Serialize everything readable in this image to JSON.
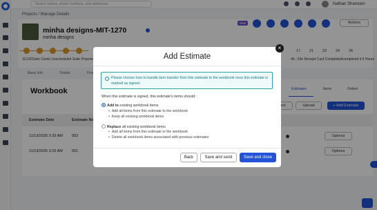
{
  "topbar": {
    "search_placeholder": "Search names, phone numbers, and addresses",
    "user_name": "Nathan Shamoon"
  },
  "breadcrumb": "Projects / Manage Details",
  "project": {
    "title": "minha designs-MIT-1270",
    "subtitle": "minha designs",
    "new_badge": "New",
    "actions_label": "Actions",
    "progress_left": "11/13/Outer Cards Unscheduled Suite Proposal",
    "progress_right": "rth : File Receipt Cauf Completed/completed it 6 Hours",
    "stages": [
      "17",
      "21",
      "23",
      "24",
      "26"
    ]
  },
  "tabs": [
    "Basic Info",
    "Details",
    "Financials"
  ],
  "workbook": {
    "title": "Workbook",
    "right_tabs": [
      "Estimates",
      "Items",
      "Orders"
    ],
    "reject_label": "Reject",
    "upload_label": "Upload",
    "add_estimate_label": "+ Add Estimate",
    "columns": [
      "Estimate Date",
      "Estimate No."
    ],
    "rows": [
      {
        "date": "11/13/2025 3:33 AM",
        "number": "002",
        "options": "Options"
      },
      {
        "date": "11/13/2025 3:33 AM",
        "number": "001",
        "options": "Options"
      }
    ]
  },
  "modal": {
    "title": "Add Estimate",
    "notice": "Please choose how to handle item transfer from this estimate to the workbook once this estimate is marked as signed.",
    "prompt": "When this estimate is signed, this estimate's items should:",
    "option1": {
      "label_bold": "Add to",
      "label_rest": "existing workbook items",
      "bullets": [
        "Add all items from this estimate to the workbook",
        "Keep all existing workbook items"
      ]
    },
    "option2": {
      "label_bold": "Replace",
      "label_rest": "all existing workbook items",
      "bullets": [
        "Add all items from this estimate to the workbook",
        "Delete all workbook items associated with previous estimates"
      ]
    },
    "back_label": "Back",
    "save_send_label": "Save and send",
    "save_close_label": "Save and close",
    "close_icon": "×"
  },
  "colors": {
    "primary": "#2352d6",
    "notice_border": "#2aa1a8",
    "stage": "#d8982a"
  }
}
